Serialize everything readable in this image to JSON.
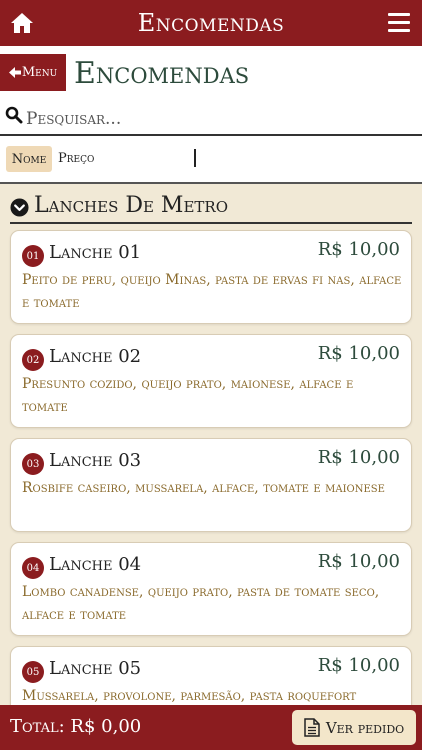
{
  "app": {
    "title": "Encomendas"
  },
  "header": {
    "menu_label": "Menu",
    "page_title": "Encomendas"
  },
  "search": {
    "placeholder": "Pesquisar...",
    "value": ""
  },
  "sort": {
    "nome_label": "Nome",
    "preco_label": "Preço"
  },
  "section": {
    "title": "Lanches De Metro"
  },
  "items": [
    {
      "badge": "01",
      "name": "Lanche 01",
      "price": "R$ 10,00",
      "desc": "Peito de peru, queijo Minas, pasta de ervas fi nas, alface e tomate"
    },
    {
      "badge": "02",
      "name": "Lanche 02",
      "price": "R$ 10,00",
      "desc": "Presunto cozido, queijo prato, maionese, alface e tomate"
    },
    {
      "badge": "03",
      "name": "Lanche 03",
      "price": "R$ 10,00",
      "desc": "Rosbife caseiro, mussarela, alface, tomate e maionese"
    },
    {
      "badge": "04",
      "name": "Lanche 04",
      "price": "R$ 10,00",
      "desc": "Lombo canadense, queijo prato, pasta de tomate seco, alface e tomate"
    },
    {
      "badge": "05",
      "name": "Lanche 05",
      "price": "R$ 10,00",
      "desc": "Mussarela, provolone, parmesão, pasta roquefort"
    }
  ],
  "footer": {
    "total": "Total: R$ 0,00",
    "ver_pedido": "Ver pedido"
  },
  "icons": {
    "home": "home-icon",
    "menu": "hamburger-menu-icon",
    "back": "arrow-left-icon",
    "search": "search-icon",
    "section": "chevron-down-circle-icon",
    "document": "document-icon"
  },
  "colors": {
    "brand": "#8b1c1f",
    "title_green": "#2d4b3c",
    "desc_gold": "#8a6a2c",
    "background": "#f1e9d6"
  }
}
